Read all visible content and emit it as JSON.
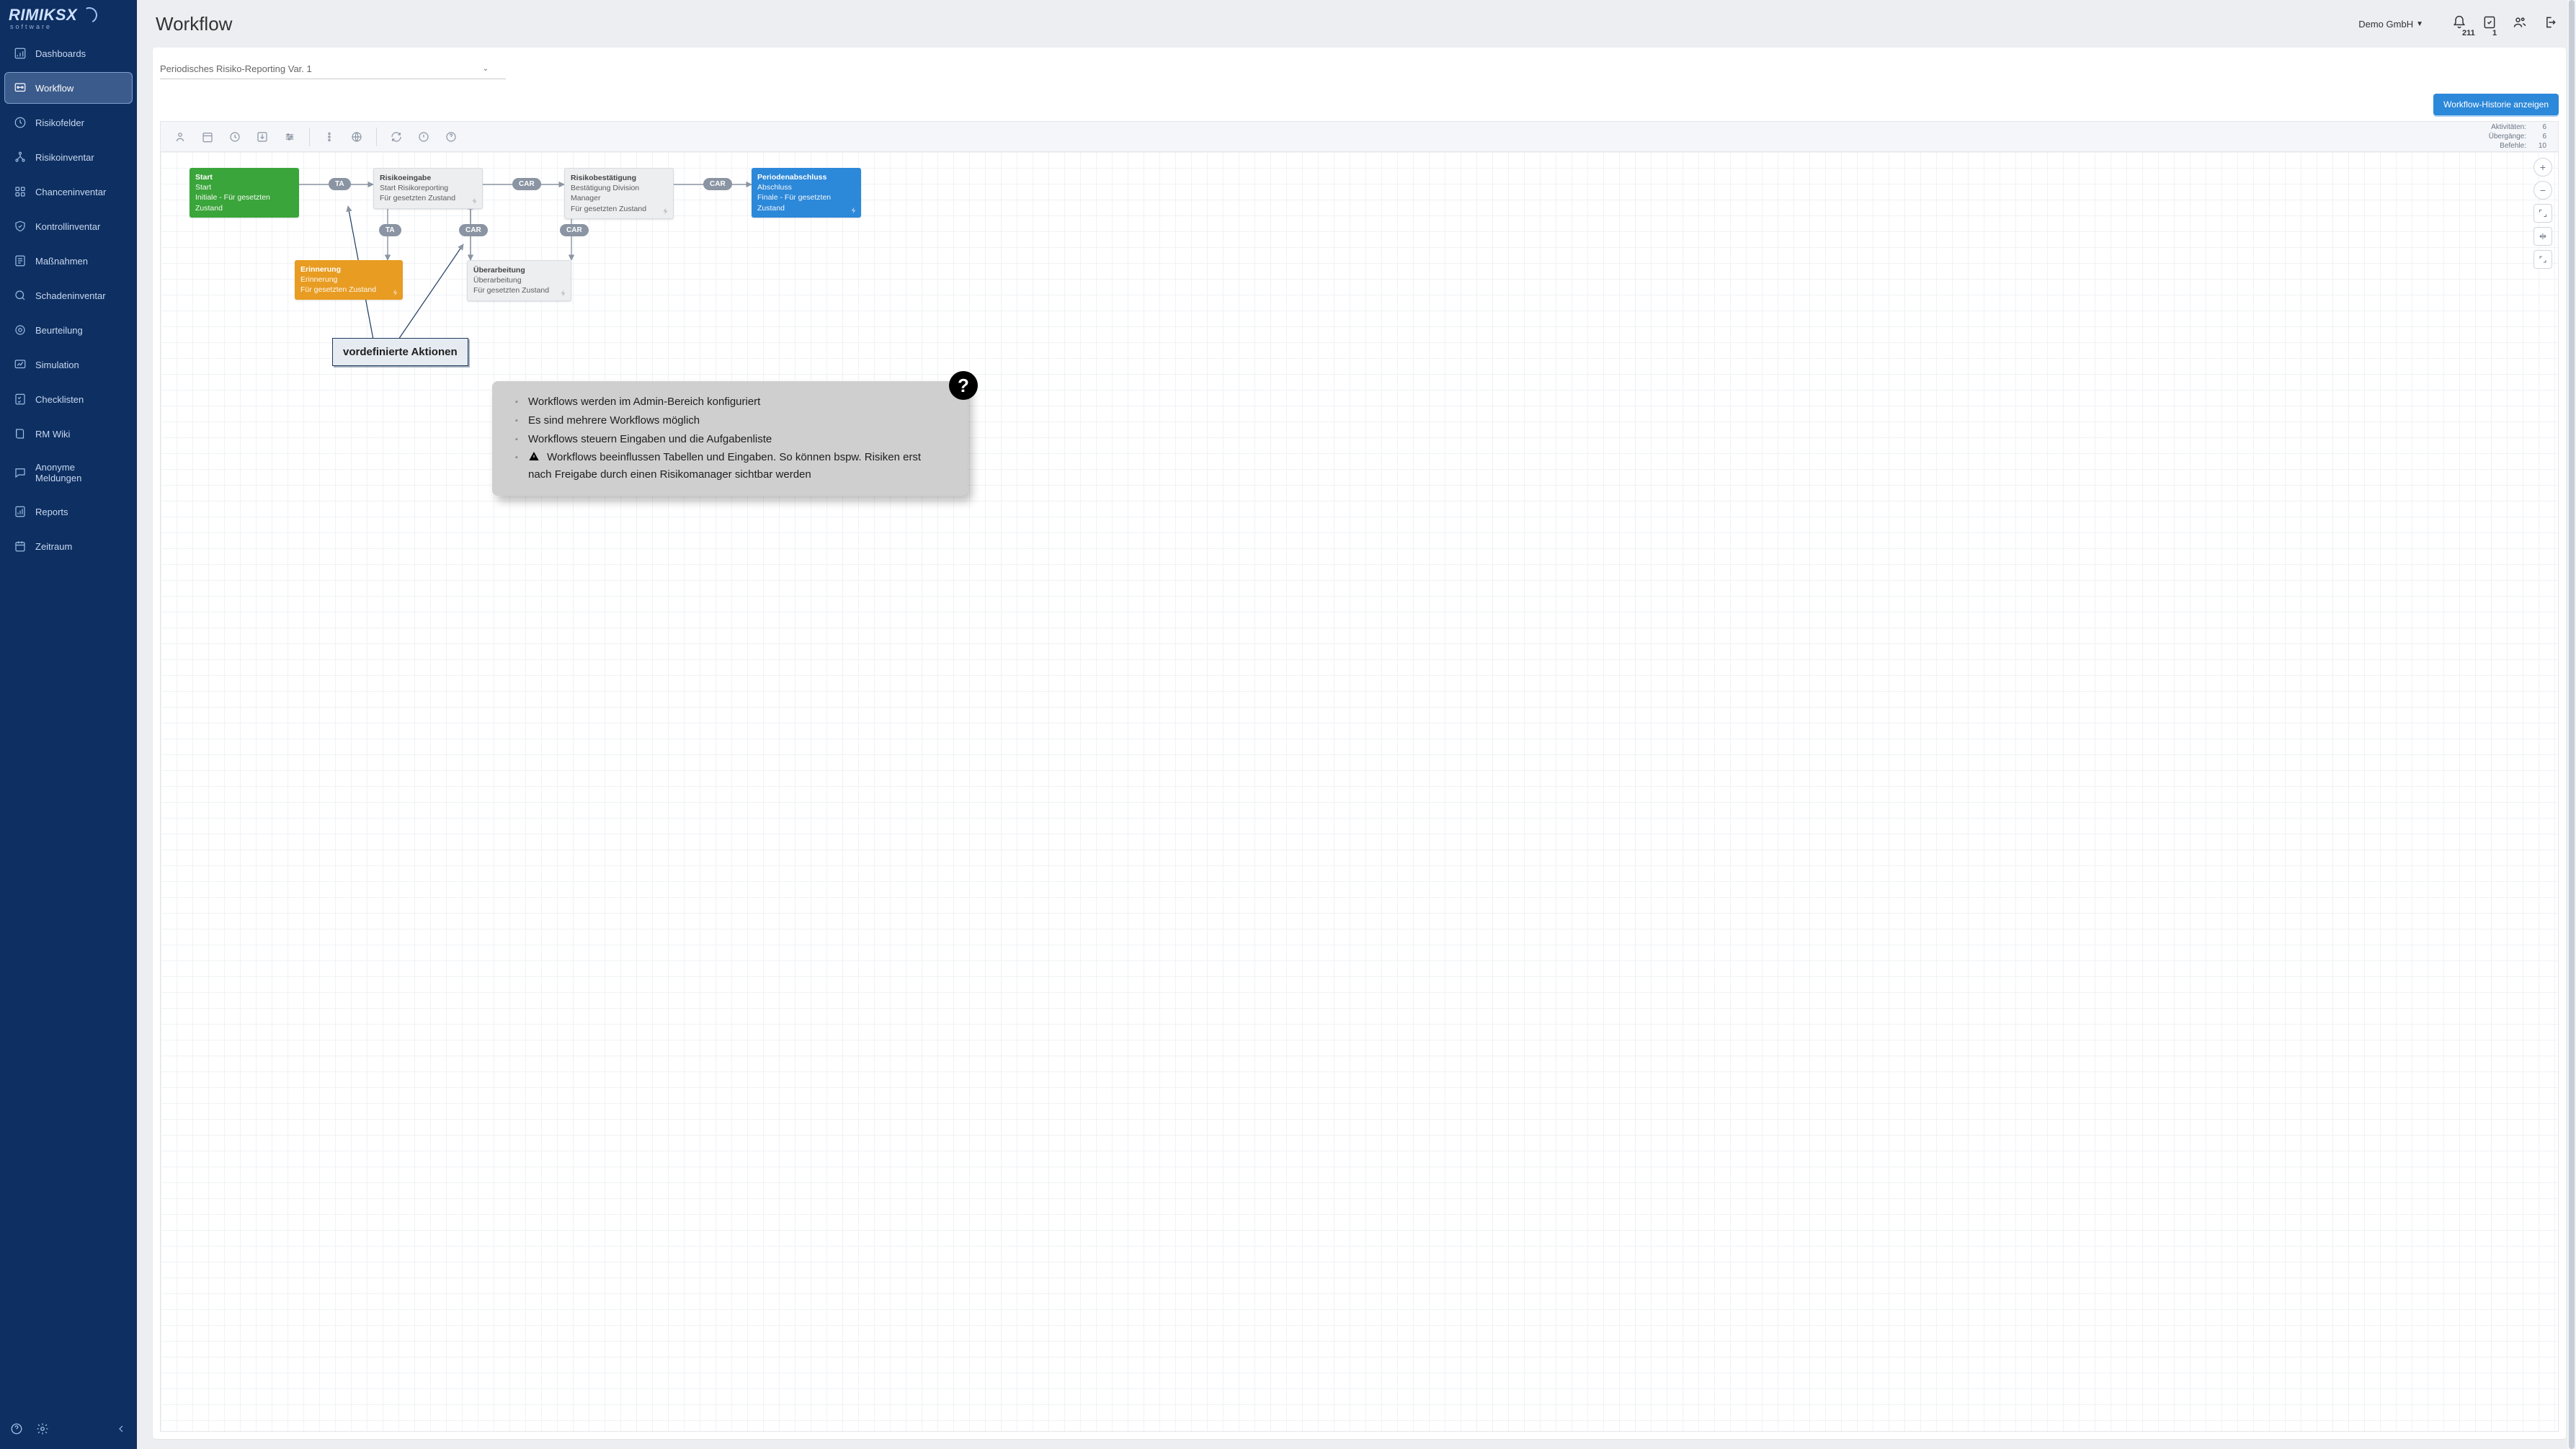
{
  "brand": {
    "name": "RIMIKSX",
    "sub": "software"
  },
  "sidebar": {
    "items": [
      {
        "label": "Dashboards"
      },
      {
        "label": "Workflow"
      },
      {
        "label": "Risikofelder"
      },
      {
        "label": "Risikoinventar"
      },
      {
        "label": "Chanceninventar"
      },
      {
        "label": "Kontrollinventar"
      },
      {
        "label": "Maßnahmen"
      },
      {
        "label": "Schadeninventar"
      },
      {
        "label": "Beurteilung"
      },
      {
        "label": "Simulation"
      },
      {
        "label": "Checklisten"
      },
      {
        "label": "RM Wiki"
      },
      {
        "label": "Anonyme Meldungen"
      },
      {
        "label": "Reports"
      },
      {
        "label": "Zeitraum"
      }
    ]
  },
  "header": {
    "title": "Workflow",
    "org": "Demo GmbH",
    "notifications": "211",
    "tasks": "1"
  },
  "selector": {
    "value": "Periodisches Risiko-Reporting Var. 1"
  },
  "buttons": {
    "history": "Workflow-Historie anzeigen"
  },
  "stats": {
    "activities_label": "Aktivitäten:",
    "activities_val": "6",
    "transitions_label": "Übergänge:",
    "transitions_val": "6",
    "commands_label": "Befehle:",
    "commands_val": "10"
  },
  "nodes": {
    "start": {
      "t1": "Start",
      "t2": "Start",
      "t3": "Initiale - Für gesetzten Zustand"
    },
    "eingabe": {
      "t1": "Risikoeingabe",
      "t2": "Start Risikoreporting",
      "t3": "Für gesetzten Zustand"
    },
    "bestaet": {
      "t1": "Risikobestätigung",
      "t2": "Bestätigung Division Manager",
      "t3": "Für gesetzten Zustand"
    },
    "abschluss": {
      "t1": "Periodenabschluss",
      "t2": "Abschluss",
      "t3": "Finale - Für gesetzten Zustand"
    },
    "erinnerung": {
      "t1": "Erinnerung",
      "t2": "Erinnerung",
      "t3": "Für gesetzten Zustand"
    },
    "ueberarb": {
      "t1": "Überarbeitung",
      "t2": "Überarbeitung",
      "t3": "Für gesetzten Zustand"
    }
  },
  "pills": {
    "ta": "TA",
    "car": "CAR"
  },
  "callout": {
    "text": "vordefinierte Aktionen"
  },
  "overlay": {
    "l1": "Workflows werden im Admin-Bereich konfiguriert",
    "l2": "Es sind mehrere Workflows möglich",
    "l3": "Workflows steuern Eingaben und die Aufgabenliste",
    "l4": "Workflows beeinflussen Tabellen und Eingaben. So können bspw. Risiken erst nach Freigabe durch einen Risikomanager sichtbar werden"
  }
}
